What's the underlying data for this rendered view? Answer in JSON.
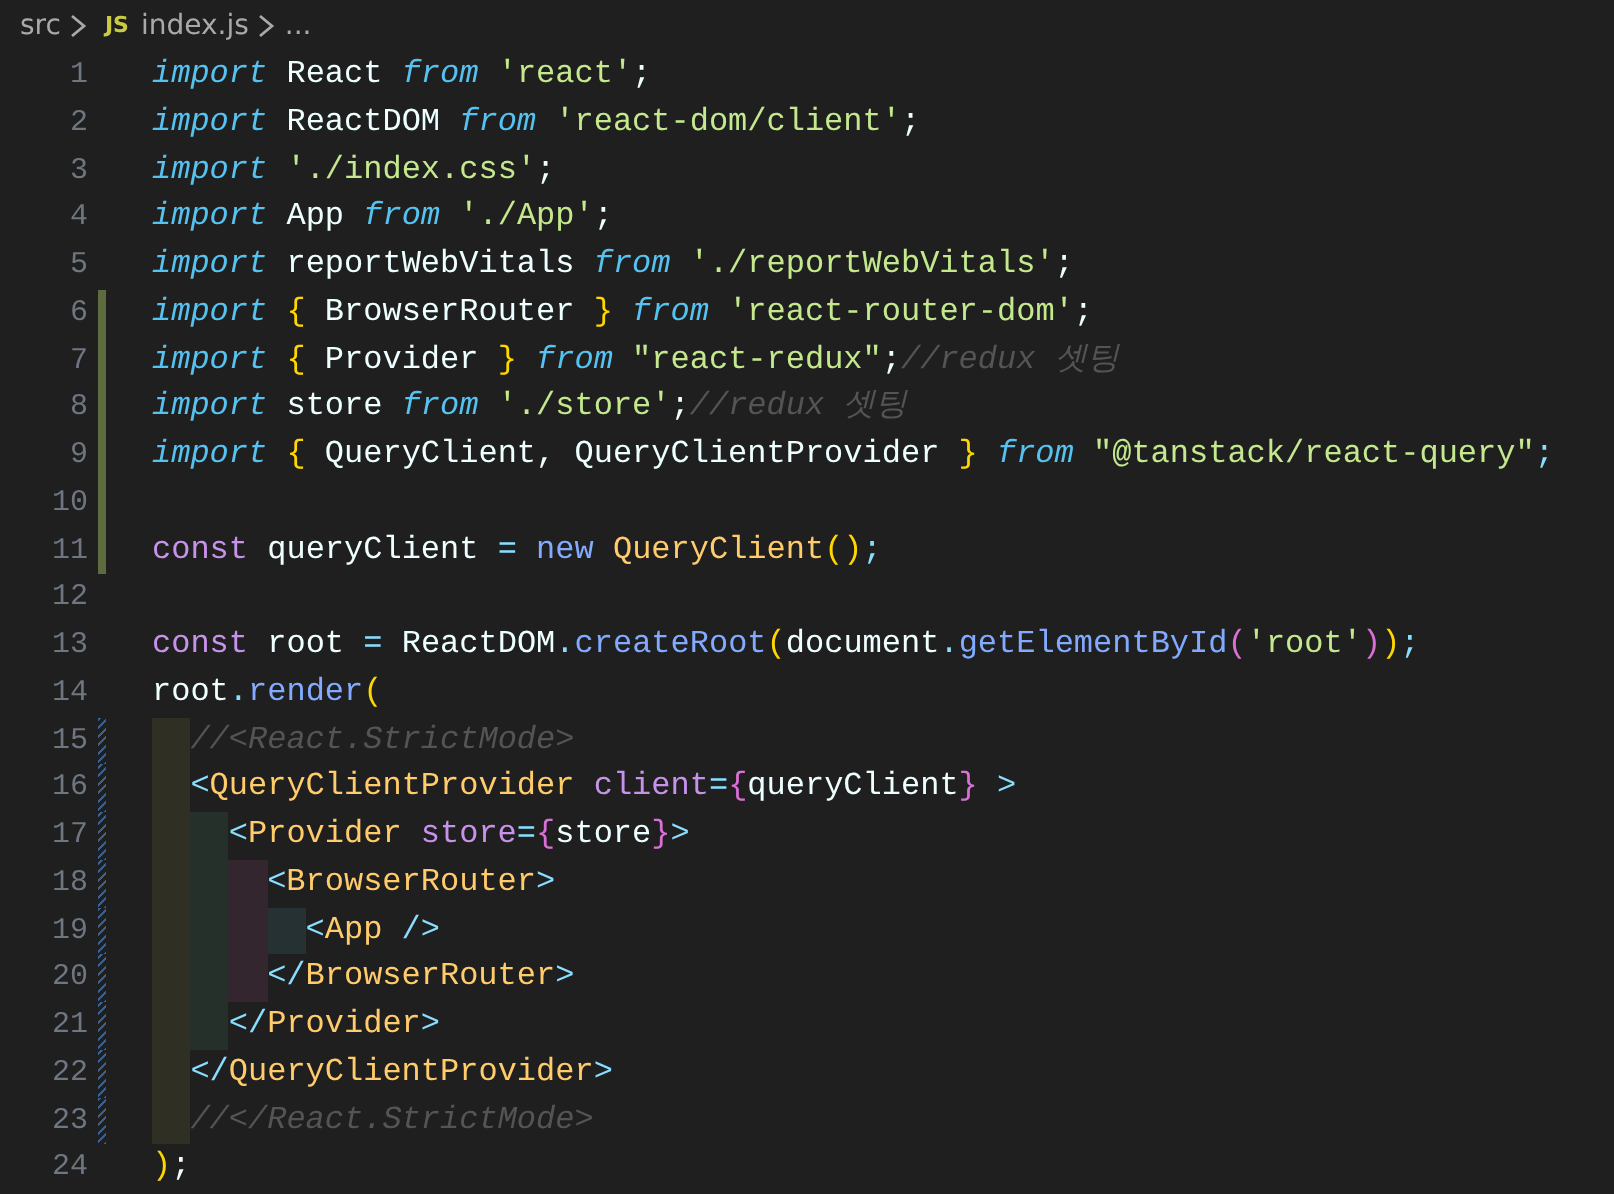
{
  "breadcrumb": {
    "folder": "src",
    "file_badge": "JS",
    "file": "index.js",
    "more": "..."
  },
  "lines": [
    {
      "number": "1",
      "added": false,
      "modified": false,
      "tokens": [
        {
          "text": "import",
          "kind": "kw"
        },
        {
          "text": " React ",
          "kind": "id"
        },
        {
          "text": "from",
          "kind": "kw"
        },
        {
          "text": " 'react'",
          "kind": "str"
        },
        {
          "text": ";",
          "kind": "semi"
        }
      ]
    },
    {
      "number": "2",
      "added": false,
      "modified": false,
      "tokens": [
        {
          "text": "import",
          "kind": "kw"
        },
        {
          "text": " ReactDOM ",
          "kind": "id"
        },
        {
          "text": "from",
          "kind": "kw"
        },
        {
          "text": " 'react-dom/client'",
          "kind": "str"
        },
        {
          "text": ";",
          "kind": "semi"
        }
      ]
    },
    {
      "number": "3",
      "added": false,
      "modified": false,
      "tokens": [
        {
          "text": "import",
          "kind": "kw"
        },
        {
          "text": " './index.css'",
          "kind": "str"
        },
        {
          "text": ";",
          "kind": "semi"
        }
      ]
    },
    {
      "number": "4",
      "added": false,
      "modified": false,
      "tokens": [
        {
          "text": "import",
          "kind": "kw"
        },
        {
          "text": " App ",
          "kind": "id"
        },
        {
          "text": "from",
          "kind": "kw"
        },
        {
          "text": " './App'",
          "kind": "str"
        },
        {
          "text": ";",
          "kind": "semi"
        }
      ]
    },
    {
      "number": "5",
      "added": false,
      "modified": false,
      "tokens": [
        {
          "text": "import",
          "kind": "kw"
        },
        {
          "text": " reportWebVitals ",
          "kind": "id"
        },
        {
          "text": "from",
          "kind": "kw"
        },
        {
          "text": " './reportWebVitals'",
          "kind": "str"
        },
        {
          "text": ";",
          "kind": "semi"
        }
      ]
    },
    {
      "number": "6",
      "added": true,
      "modified": false,
      "tokens": [
        {
          "text": "import",
          "kind": "kw"
        },
        {
          "text": " {",
          "kind": "brace"
        },
        {
          "text": " BrowserRouter ",
          "kind": "id"
        },
        {
          "text": "}",
          "kind": "brace"
        },
        {
          "text": " from",
          "kind": "kw"
        },
        {
          "text": " 'react-router-dom'",
          "kind": "str"
        },
        {
          "text": ";",
          "kind": "semi"
        }
      ]
    },
    {
      "number": "7",
      "added": true,
      "modified": false,
      "tokens": [
        {
          "text": "import",
          "kind": "kw"
        },
        {
          "text": " {",
          "kind": "brace"
        },
        {
          "text": " Provider ",
          "kind": "id"
        },
        {
          "text": "}",
          "kind": "brace"
        },
        {
          "text": " from",
          "kind": "kw"
        },
        {
          "text": " \"react-redux\"",
          "kind": "str"
        },
        {
          "text": ";",
          "kind": "semi"
        },
        {
          "text": "//redux 셋팅",
          "kind": "comment"
        }
      ]
    },
    {
      "number": "8",
      "added": true,
      "modified": false,
      "tokens": [
        {
          "text": "import",
          "kind": "kw"
        },
        {
          "text": " store ",
          "kind": "id"
        },
        {
          "text": "from",
          "kind": "kw"
        },
        {
          "text": " './store'",
          "kind": "str"
        },
        {
          "text": ";",
          "kind": "semi"
        },
        {
          "text": "//redux 셋팅",
          "kind": "comment"
        }
      ]
    },
    {
      "number": "9",
      "added": true,
      "modified": false,
      "tokens": [
        {
          "text": "import",
          "kind": "kw"
        },
        {
          "text": " {",
          "kind": "brace"
        },
        {
          "text": " QueryClient, QueryClientProvider ",
          "kind": "id"
        },
        {
          "text": "}",
          "kind": "brace"
        },
        {
          "text": " from",
          "kind": "kw"
        },
        {
          "text": " \"@tanstack/react-query\"",
          "kind": "str"
        },
        {
          "text": ";",
          "kind": "punct"
        }
      ]
    },
    {
      "number": "10",
      "added": true,
      "modified": false
    },
    {
      "number": "11",
      "added": true,
      "modified": false,
      "tokens": [
        {
          "text": "const",
          "kind": "decl"
        },
        {
          "text": " queryClient ",
          "kind": "id"
        },
        {
          "text": "=",
          "kind": "punct"
        },
        {
          "text": " new",
          "kind": "fn"
        },
        {
          "text": " QueryClient",
          "kind": "cls"
        },
        {
          "text": "()",
          "kind": "brace"
        },
        {
          "text": ";",
          "kind": "punct"
        }
      ]
    },
    {
      "number": "12",
      "added": false,
      "modified": false
    },
    {
      "number": "13",
      "added": false,
      "modified": false,
      "tokens": [
        {
          "text": "const",
          "kind": "decl"
        },
        {
          "text": " root ",
          "kind": "id"
        },
        {
          "text": "=",
          "kind": "punct"
        },
        {
          "text": " ReactDOM",
          "kind": "id"
        },
        {
          "text": ".",
          "kind": "punct"
        },
        {
          "text": "createRoot",
          "kind": "fn"
        },
        {
          "text": "(",
          "kind": "brace"
        },
        {
          "text": "document",
          "kind": "id"
        },
        {
          "text": ".",
          "kind": "punct"
        },
        {
          "text": "getElementById",
          "kind": "fn"
        },
        {
          "text": "(",
          "kind": "brace2"
        },
        {
          "text": "'root'",
          "kind": "str"
        },
        {
          "text": ")",
          "kind": "brace2"
        },
        {
          "text": ")",
          "kind": "brace"
        },
        {
          "text": ";",
          "kind": "punct"
        }
      ]
    },
    {
      "number": "14",
      "added": false,
      "modified": false,
      "tokens": [
        {
          "text": "root",
          "kind": "id"
        },
        {
          "text": ".",
          "kind": "punct"
        },
        {
          "text": "render",
          "kind": "fn"
        },
        {
          "text": "(",
          "kind": "brace"
        }
      ]
    },
    {
      "number": "15",
      "added": false,
      "modified": true,
      "indent_guides": [
        {
          "color": "#2f2f24"
        }
      ],
      "tokens": [
        {
          "text": "//<React.StrictMode>",
          "kind": "comment"
        }
      ]
    },
    {
      "number": "16",
      "added": false,
      "modified": true,
      "indent_guides": [
        {
          "color": "#2f2f24"
        }
      ],
      "tokens": [
        {
          "text": "<",
          "kind": "punct"
        },
        {
          "text": "QueryClientProvider",
          "kind": "tag"
        },
        {
          "text": " client",
          "kind": "attr"
        },
        {
          "text": "=",
          "kind": "punct"
        },
        {
          "text": "{",
          "kind": "brace2"
        },
        {
          "text": "queryClient",
          "kind": "id"
        },
        {
          "text": "}",
          "kind": "brace2"
        },
        {
          "text": " >",
          "kind": "punct"
        }
      ]
    },
    {
      "number": "17",
      "added": false,
      "modified": true,
      "indent_guides": [
        {
          "color": "#2f2f24"
        },
        {
          "color": "#25302a"
        }
      ],
      "tokens": [
        {
          "text": "<",
          "kind": "punct"
        },
        {
          "text": "Provider",
          "kind": "tag"
        },
        {
          "text": " store",
          "kind": "attr"
        },
        {
          "text": "=",
          "kind": "punct"
        },
        {
          "text": "{",
          "kind": "brace2"
        },
        {
          "text": "store",
          "kind": "id"
        },
        {
          "text": "}",
          "kind": "brace2"
        },
        {
          "text": ">",
          "kind": "punct"
        }
      ]
    },
    {
      "number": "18",
      "added": false,
      "modified": true,
      "indent_guides": [
        {
          "color": "#2f2f24"
        },
        {
          "color": "#25302a"
        },
        {
          "color": "#33262f"
        }
      ],
      "tokens": [
        {
          "text": "<",
          "kind": "punct"
        },
        {
          "text": "BrowserRouter",
          "kind": "tag"
        },
        {
          "text": ">",
          "kind": "punct"
        }
      ]
    },
    {
      "number": "19",
      "added": false,
      "modified": true,
      "indent_guides": [
        {
          "color": "#2f2f24"
        },
        {
          "color": "#25302a"
        },
        {
          "color": "#33262f"
        },
        {
          "color": "#263134"
        }
      ],
      "tokens": [
        {
          "text": "<",
          "kind": "punct"
        },
        {
          "text": "App",
          "kind": "tag"
        },
        {
          "text": " />",
          "kind": "punct"
        }
      ]
    },
    {
      "number": "20",
      "added": false,
      "modified": true,
      "indent_guides": [
        {
          "color": "#2f2f24"
        },
        {
          "color": "#25302a"
        },
        {
          "color": "#33262f"
        }
      ],
      "tokens": [
        {
          "text": "</",
          "kind": "punct"
        },
        {
          "text": "BrowserRouter",
          "kind": "tag"
        },
        {
          "text": ">",
          "kind": "punct"
        }
      ]
    },
    {
      "number": "21",
      "added": false,
      "modified": true,
      "indent_guides": [
        {
          "color": "#2f2f24"
        },
        {
          "color": "#25302a"
        }
      ],
      "tokens": [
        {
          "text": "</",
          "kind": "punct"
        },
        {
          "text": "Provider",
          "kind": "tag"
        },
        {
          "text": ">",
          "kind": "punct"
        }
      ]
    },
    {
      "number": "22",
      "added": false,
      "modified": true,
      "indent_guides": [
        {
          "color": "#2f2f24"
        }
      ],
      "tokens": [
        {
          "text": "</",
          "kind": "punct"
        },
        {
          "text": "QueryClientProvider",
          "kind": "tag"
        },
        {
          "text": ">",
          "kind": "punct"
        }
      ]
    },
    {
      "number": "23",
      "added": false,
      "modified": true,
      "indent_guides": [
        {
          "color": "#2f2f24"
        }
      ],
      "tokens": [
        {
          "text": "//</React.StrictMode>",
          "kind": "comment"
        }
      ]
    },
    {
      "number": "24",
      "added": false,
      "modified": false,
      "tokens": [
        {
          "text": ")",
          "kind": "brace"
        },
        {
          "text": ";",
          "kind": "semi"
        }
      ]
    }
  ]
}
